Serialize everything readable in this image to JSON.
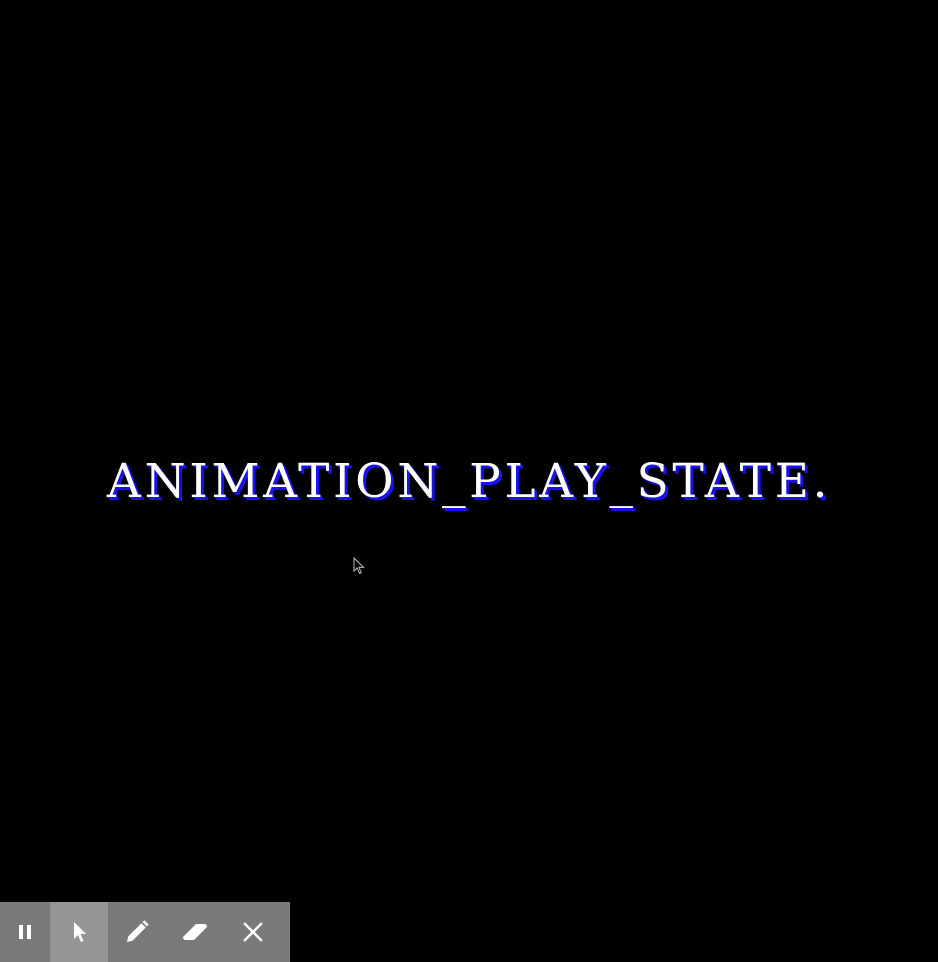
{
  "slide": {
    "title": "ANIMATION_PLAY_STATE."
  },
  "colors": {
    "background": "#000000",
    "title_text": "#ffffff",
    "title_shadow": "#1a12e6",
    "toolbar": "#7a7a7a",
    "toolbar_active": "#969696"
  },
  "toolbar": {
    "buttons": [
      {
        "icon": "pause-icon",
        "active": false
      },
      {
        "icon": "pointer-icon",
        "active": true
      },
      {
        "icon": "pen-icon",
        "active": false
      },
      {
        "icon": "eraser-icon",
        "active": false
      },
      {
        "icon": "close-icon",
        "active": false
      }
    ]
  }
}
